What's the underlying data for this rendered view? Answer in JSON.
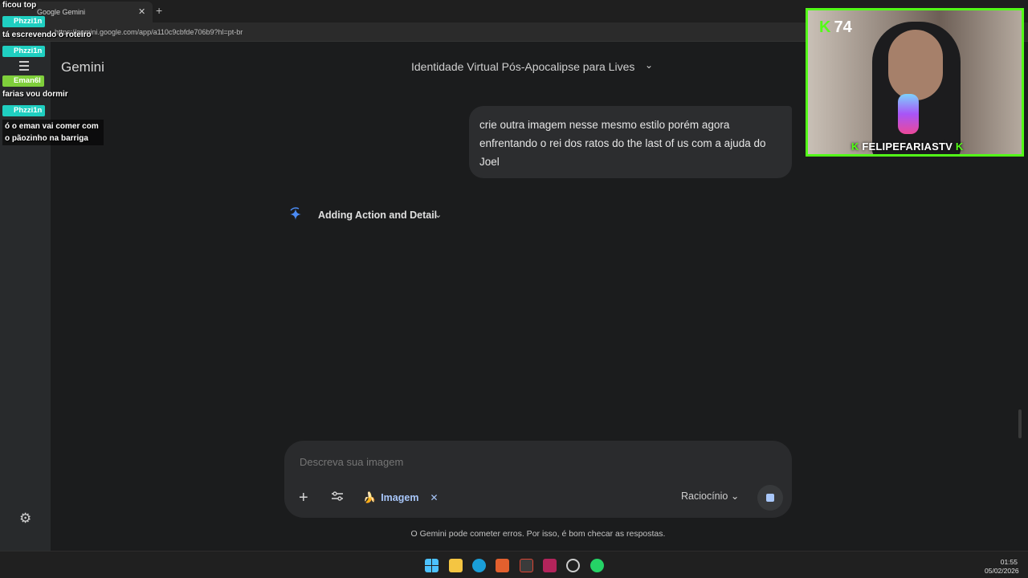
{
  "browser": {
    "tab_title": "Google Gemini",
    "url": "https://gemini.google.com/app/a110c9cbfde706b9?hl=pt-br"
  },
  "app": {
    "title": "Gemini",
    "conversation_title": "Identidade Virtual Pós-Apocalipse para Lives"
  },
  "chat": {
    "user_message": "crie outra imagem nesse mesmo estilo porém agora enfrentando o rei dos ratos do the last of us com a ajuda do Joel",
    "status": "Adding Action and Detail"
  },
  "composer": {
    "placeholder": "Descreva sua imagem",
    "tool_chip": "Imagem",
    "mode": "Raciocínio"
  },
  "disclaimer": "O Gemini pode cometer erros. Por isso, é bom checar as respostas.",
  "stream_chat": [
    {
      "user": "",
      "text": "ficou top"
    },
    {
      "user": "Phzzi1n",
      "text": "tá escrevendo o roteiro"
    },
    {
      "user": "Phzzi1n",
      "text": ""
    },
    {
      "user": "Eman6l",
      "text": "farias vou dormir"
    },
    {
      "user": "Phzzi1n",
      "text": "ó o eman vai comer com o pãozinho na barriga"
    }
  ],
  "webcam": {
    "viewer_count": "74",
    "streamer_name": "FELIPEFARIASTV"
  },
  "taskbar": {
    "time": "01:55",
    "date": "05/02/2026"
  },
  "colors": {
    "accent": "#a8c7fa",
    "kick_green": "#53fc18",
    "background": "#1b1c1d"
  }
}
